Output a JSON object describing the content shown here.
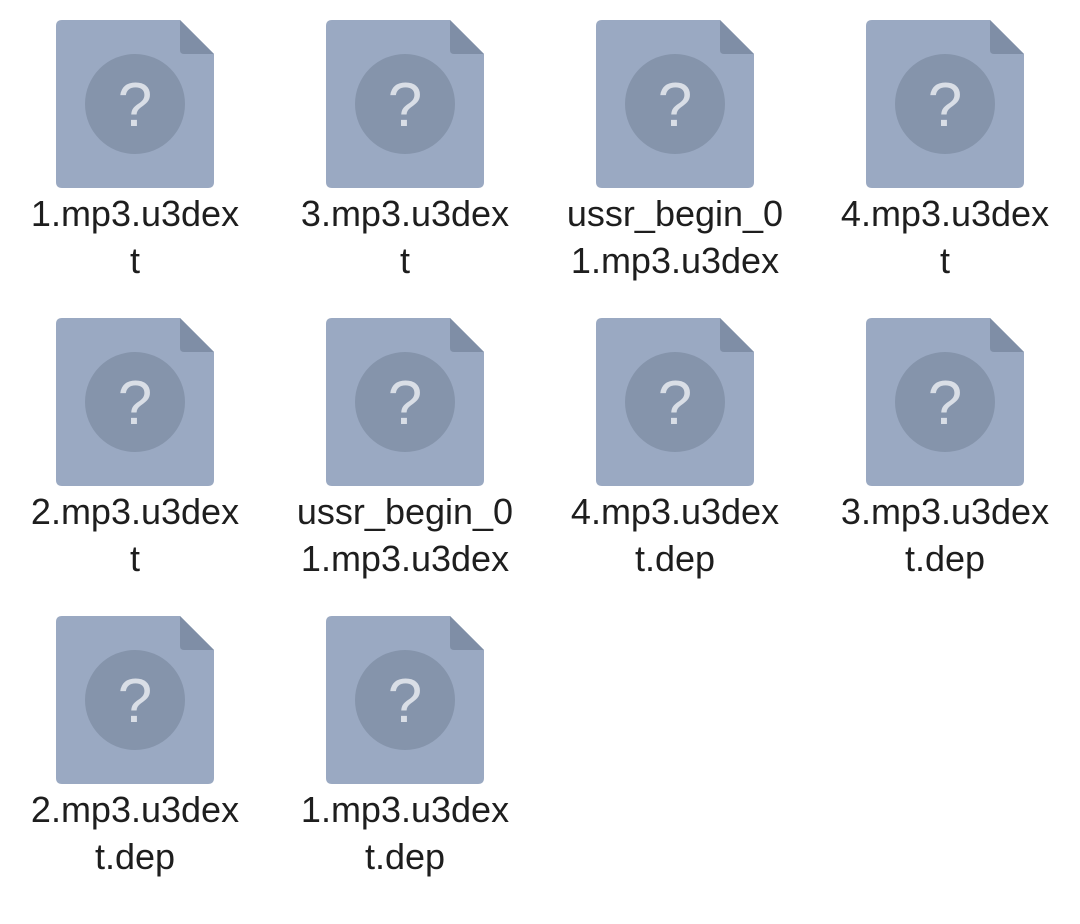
{
  "icon": {
    "name": "unknown-file-icon",
    "glyph": "?",
    "body_color": "#9aa9c2",
    "fold_color": "#7f8ea6",
    "circle_color": "#8594ab",
    "glyph_color": "#d9dee6"
  },
  "files": [
    {
      "line1": "1.mp3.u3dex",
      "line2": "t"
    },
    {
      "line1": "3.mp3.u3dex",
      "line2": "t"
    },
    {
      "line1": "ussr_begin_0",
      "line2": "1.mp3.u3dex"
    },
    {
      "line1": "4.mp3.u3dex",
      "line2": "t"
    },
    {
      "line1": "2.mp3.u3dex",
      "line2": "t"
    },
    {
      "line1": "ussr_begin_0",
      "line2": "1.mp3.u3dex"
    },
    {
      "line1": "4.mp3.u3dex",
      "line2": "t.dep"
    },
    {
      "line1": "3.mp3.u3dex",
      "line2": "t.dep"
    },
    {
      "line1": "2.mp3.u3dex",
      "line2": "t.dep"
    },
    {
      "line1": "1.mp3.u3dex",
      "line2": "t.dep"
    }
  ]
}
